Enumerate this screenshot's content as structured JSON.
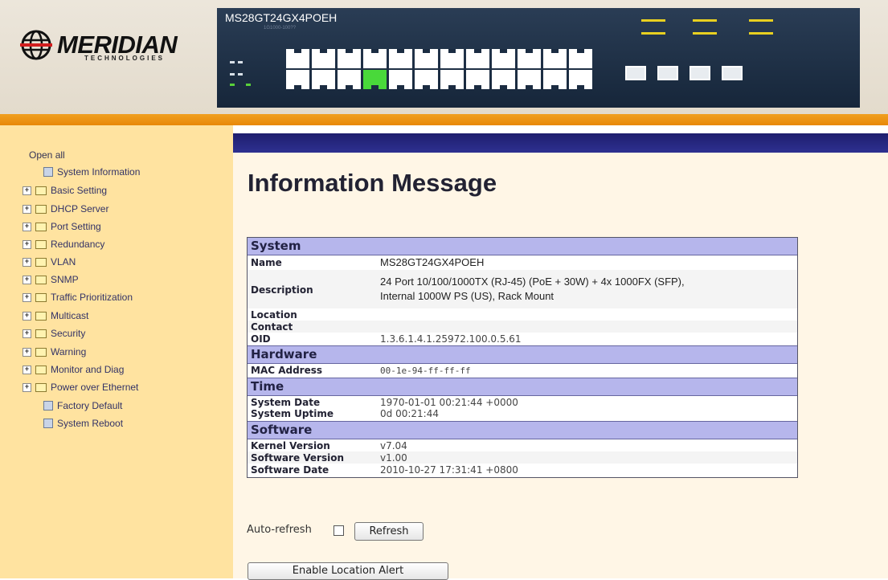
{
  "header": {
    "brand": "MERIDIAN",
    "brand_sub": "TECHNOLOGIES",
    "device_model": "MS28GT24GX4POEH",
    "device_serial": "1G1000-100??"
  },
  "sidebar": {
    "open_all": "Open all",
    "items": [
      {
        "label": "System Information",
        "type": "page"
      },
      {
        "label": "Basic Setting",
        "type": "folder"
      },
      {
        "label": "DHCP Server",
        "type": "folder"
      },
      {
        "label": "Port Setting",
        "type": "folder"
      },
      {
        "label": "Redundancy",
        "type": "folder"
      },
      {
        "label": "VLAN",
        "type": "folder"
      },
      {
        "label": "SNMP",
        "type": "folder"
      },
      {
        "label": "Traffic Prioritization",
        "type": "folder"
      },
      {
        "label": "Multicast",
        "type": "folder"
      },
      {
        "label": "Security",
        "type": "folder"
      },
      {
        "label": "Warning",
        "type": "folder"
      },
      {
        "label": "Monitor and Diag",
        "type": "folder"
      },
      {
        "label": "Power over Ethernet",
        "type": "folder"
      },
      {
        "label": "Factory Default",
        "type": "page"
      },
      {
        "label": "System Reboot",
        "type": "page"
      }
    ]
  },
  "main": {
    "title": "Information Message",
    "system": {
      "heading": "System",
      "name_label": "Name",
      "name_value": "MS28GT24GX4POEH",
      "desc_label": "Description",
      "desc_value_line1": "24 Port 10/100/1000TX (RJ-45) (PoE + 30W)  + 4x 1000FX (SFP),",
      "desc_value_line2": "Internal 1000W PS (US), Rack Mount",
      "location_label": "Location",
      "location_value": "",
      "contact_label": "Contact",
      "contact_value": "",
      "oid_label": "OID",
      "oid_value": "1.3.6.1.4.1.25972.100.0.5.61"
    },
    "hardware": {
      "heading": "Hardware",
      "mac_label": "MAC Address",
      "mac_value": "00-1e-94-ff-ff-ff"
    },
    "time": {
      "heading": "Time",
      "date_label": "System Date",
      "date_value": "1970-01-01 00:21:44 +0000",
      "uptime_label": "System Uptime",
      "uptime_value": "0d 00:21:44"
    },
    "software": {
      "heading": "Software",
      "kernel_label": "Kernel Version",
      "kernel_value": "v7.04",
      "sw_label": "Software Version",
      "sw_value": "v1.00",
      "swdate_label": "Software Date",
      "swdate_value": "2010-10-27 17:31:41 +0800"
    },
    "auto_refresh_label": "Auto-refresh",
    "auto_refresh_checked": false,
    "refresh_button": "Refresh",
    "location_alert_button": "Enable Location Alert"
  }
}
